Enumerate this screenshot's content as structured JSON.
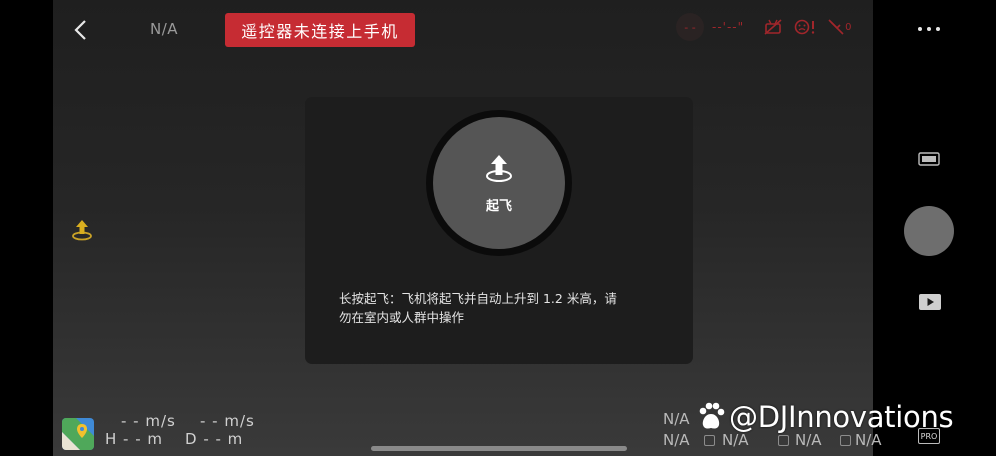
{
  "top_bar": {
    "left_status": "N/A",
    "warning_banner": "遥控器未连接上手机",
    "signal_text": "- -",
    "gps_text": "--'--\"",
    "battery_sub": "0"
  },
  "dialog": {
    "takeoff_label": "起飞",
    "message_line1": "长按起飞：飞机将起飞并自动上升到 1.2 米高，请",
    "message_line2": "勿在室内或人群中操作"
  },
  "telemetry": {
    "h_speed": "- - m/s",
    "v_speed": "- - m/s",
    "height": "H - - m",
    "distance": "D - - m"
  },
  "camera_params": {
    "row1_a": "N/A",
    "row2_a": "N/A",
    "row2_b": "N/A",
    "row2_c": "N/A",
    "row2_d": "N/A"
  },
  "right_rail": {
    "pro_label": "PRO"
  },
  "watermark": {
    "text": "@DJInnovations"
  },
  "colors": {
    "warning": "#c62c33",
    "alert_icon": "#a1262b",
    "takeoff_accent": "#f0c419"
  }
}
